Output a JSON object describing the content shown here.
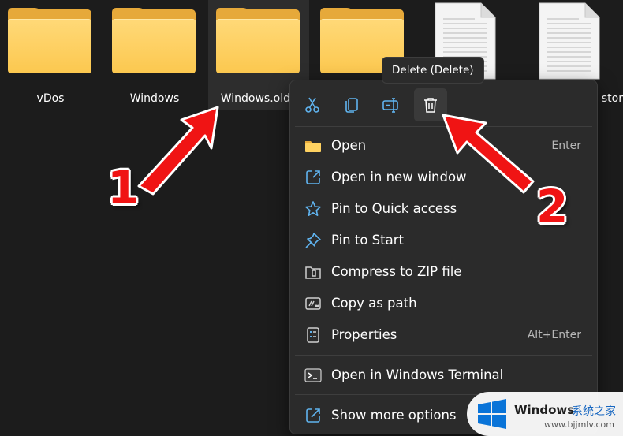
{
  "files": [
    {
      "name": "vDos",
      "type": "folder"
    },
    {
      "name": "Windows",
      "type": "folder"
    },
    {
      "name": "Windows.old",
      "type": "folder",
      "selected": true
    },
    {
      "name": "",
      "type": "folder"
    },
    {
      "name": "",
      "type": "document"
    },
    {
      "name": "stor",
      "type": "document"
    }
  ],
  "tooltip": "Delete (Delete)",
  "quick_actions": [
    {
      "icon": "scissors-icon",
      "action": "cut"
    },
    {
      "icon": "copy-icon",
      "action": "copy"
    },
    {
      "icon": "rename-icon",
      "action": "rename"
    },
    {
      "icon": "trash-icon",
      "action": "delete",
      "hovered": true
    }
  ],
  "menu": {
    "items": [
      {
        "label": "Open",
        "shortcut": "Enter",
        "icon": "folder-icon"
      },
      {
        "label": "Open in new window",
        "shortcut": "",
        "icon": "open-new-window-icon"
      },
      {
        "label": "Pin to Quick access",
        "shortcut": "",
        "icon": "star-icon"
      },
      {
        "label": "Pin to Start",
        "shortcut": "",
        "icon": "pin-icon"
      },
      {
        "label": "Compress to ZIP file",
        "shortcut": "",
        "icon": "zip-icon"
      },
      {
        "label": "Copy as path",
        "shortcut": "",
        "icon": "copy-path-icon"
      },
      {
        "label": "Properties",
        "shortcut": "Alt+Enter",
        "icon": "properties-icon"
      }
    ],
    "terminal": {
      "label": "Open in Windows Terminal",
      "icon": "terminal-icon"
    },
    "more": {
      "label": "Show more options",
      "icon": "more-options-icon"
    }
  },
  "annotations": {
    "step1": "1",
    "step2": "2"
  },
  "watermark": {
    "brand": "Windows",
    "cn": "系统之家",
    "url": "www.bjjmlv.com"
  },
  "colors": {
    "background": "#1c1c1c",
    "menu_bg": "#2b2b2b",
    "accent_blue": "#60b4f0",
    "folder_yellow": "#fcc84f",
    "arrow_red": "#f01414"
  }
}
